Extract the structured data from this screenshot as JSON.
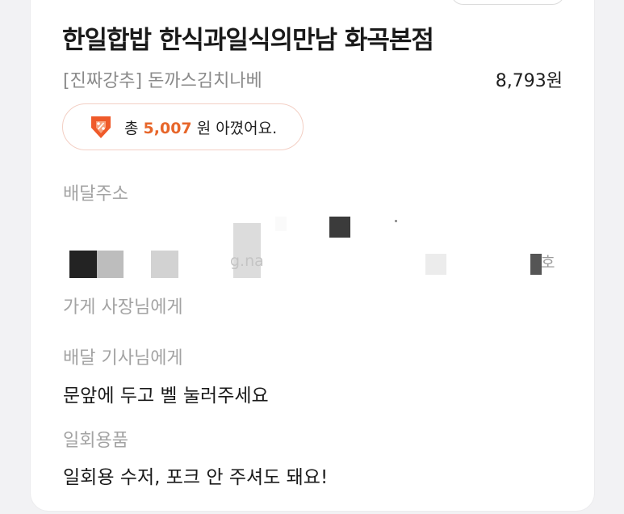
{
  "store": {
    "name": "한일합밥 한식과일식의만남 화곡본점"
  },
  "order": {
    "menu_name": "[진짜강추] 돈까스김치나베",
    "price": "8,793원"
  },
  "savings": {
    "prefix": "총",
    "amount": "5,007",
    "suffix": "원 아꼈어요.",
    "accent_color": "#e7662a",
    "icon": "discount-tag-icon"
  },
  "delivery_address": {
    "label": "배달주소",
    "visible_fragment": "g.na",
    "trailing_fragment": "호"
  },
  "to_store_owner": {
    "label": "가게 사장님에게"
  },
  "to_rider": {
    "label": "배달 기사님에게",
    "message": "문앞에 두고 벨 눌러주세요"
  },
  "disposables": {
    "label": "일회용품",
    "message": "일회용 수저, 포크 안 주셔도 돼요!"
  }
}
